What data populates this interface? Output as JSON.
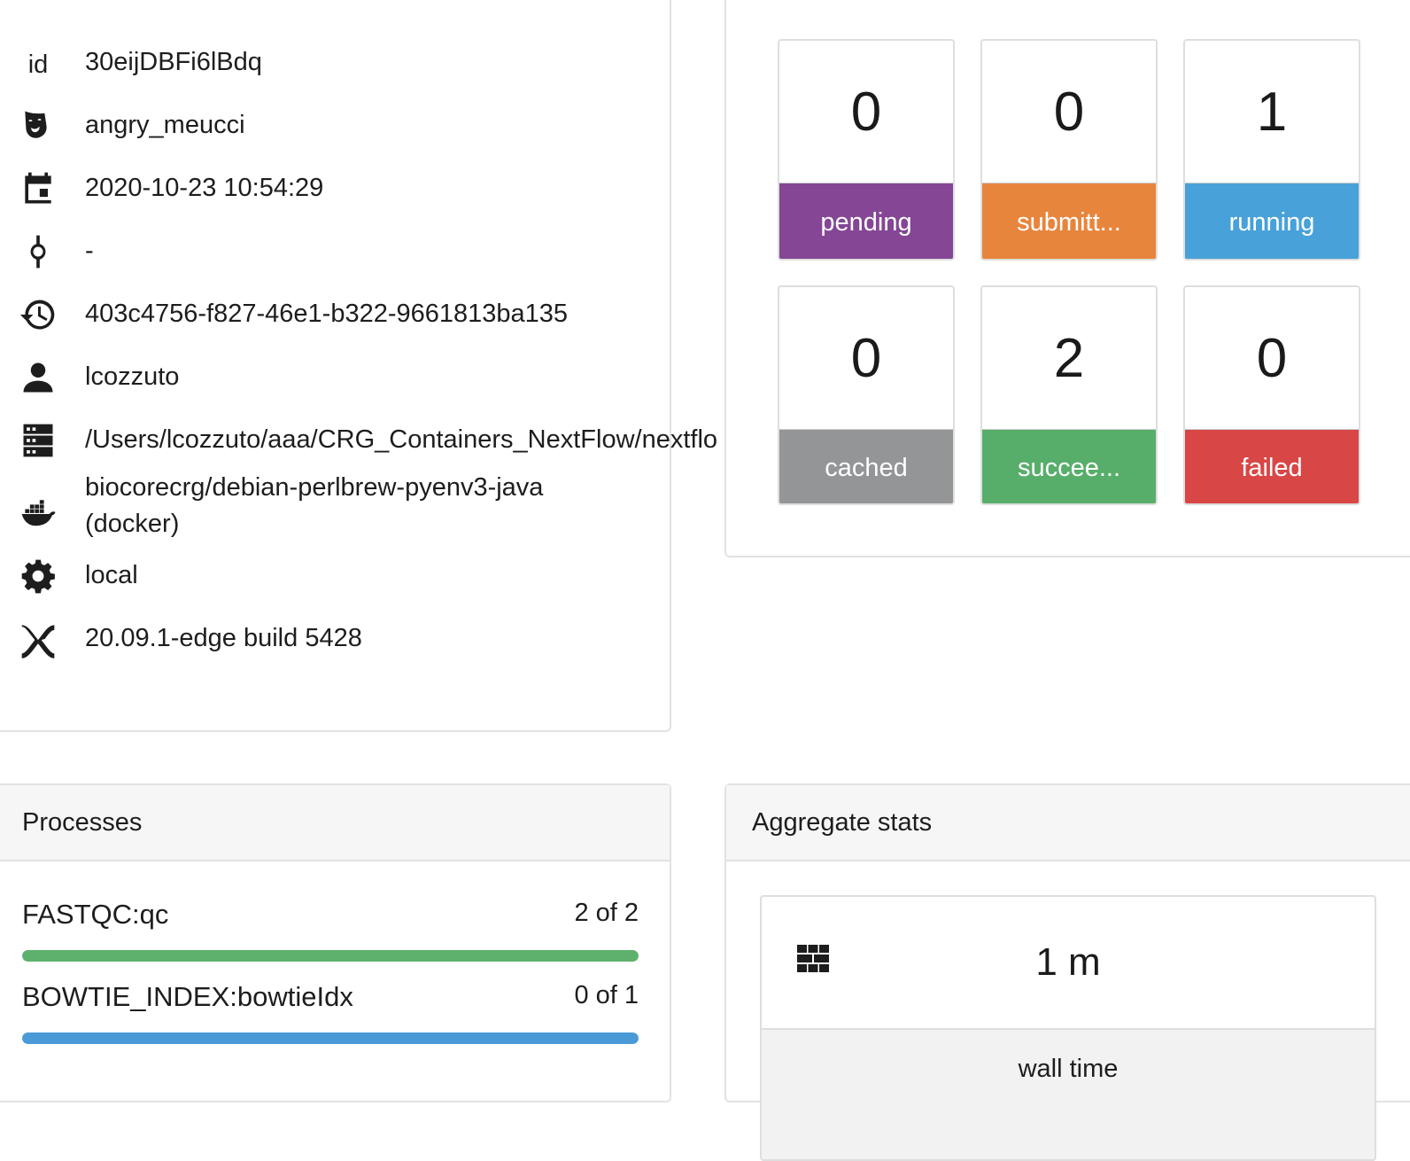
{
  "workflow": {
    "id_label": "id",
    "id": "30eijDBFi6lBdq",
    "run_name": "angry_meucci",
    "start_time": "2020-10-23 10:54:29",
    "revision": "-",
    "session_id": "403c4756-f827-46e1-b322-9661813ba135",
    "user": "lcozzuto",
    "work_dir": "/Users/lcozzuto/aaa/CRG_Containers_NextFlow/nextflo",
    "container_line1": "biocorecrg/debian-perlbrew-pyenv3-java",
    "container_line2": "(docker)",
    "executor": "local",
    "nextflow_version": "20.09.1-edge build 5428",
    "icons": [
      "id-label",
      "theater-masks-icon",
      "calendar-icon",
      "commit-icon",
      "history-icon",
      "user-icon",
      "server-icon",
      "docker-icon",
      "gear-icon",
      "nextflow-icon"
    ]
  },
  "status": {
    "tiles": [
      {
        "key": "pending",
        "count": "0",
        "label": "pending",
        "color": "#844695"
      },
      {
        "key": "submitted",
        "count": "0",
        "label": "submitt...",
        "color": "#e8853c"
      },
      {
        "key": "running",
        "count": "1",
        "label": "running",
        "color": "#48a1d9"
      },
      {
        "key": "cached",
        "count": "0",
        "label": "cached",
        "color": "#949597"
      },
      {
        "key": "succeeded",
        "count": "2",
        "label": "succee...",
        "color": "#57ae6a"
      },
      {
        "key": "failed",
        "count": "0",
        "label": "failed",
        "color": "#d84646"
      }
    ]
  },
  "processes": {
    "title": "Processes",
    "items": [
      {
        "name": "FASTQC:qc",
        "count": "2 of 2",
        "progress": 1.0,
        "color": "#5db16c"
      },
      {
        "name": "BOWTIE_INDEX:bowtieIdx",
        "count": "0 of 1",
        "progress": 1.0,
        "color": "#4a9ad8"
      }
    ]
  },
  "aggregate": {
    "title": "Aggregate stats",
    "wall_time_value": "1 m",
    "wall_time_label": "wall time",
    "icon": "cubes-icon"
  }
}
